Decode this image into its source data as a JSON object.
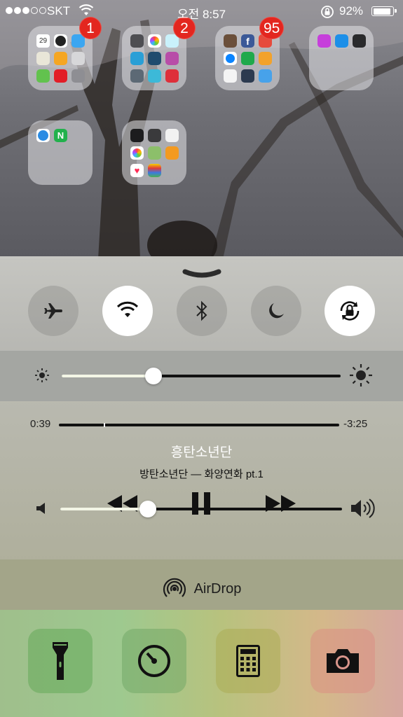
{
  "status_bar": {
    "carrier": "SKT",
    "time": "오전 8:57",
    "battery": "92%"
  },
  "folders": [
    {
      "badge": "1"
    },
    {
      "badge": "2"
    },
    {
      "badge": "95"
    },
    {
      "badge": ""
    },
    {
      "badge": ""
    },
    {
      "badge": ""
    }
  ],
  "calendar_day": "29",
  "control_center": {
    "toggles": [
      {
        "name": "airplane-mode",
        "on": false
      },
      {
        "name": "wifi",
        "on": true
      },
      {
        "name": "bluetooth",
        "on": false
      },
      {
        "name": "do-not-disturb",
        "on": false
      },
      {
        "name": "rotation-lock",
        "on": true
      }
    ],
    "brightness": 0.33,
    "music": {
      "elapsed": "0:39",
      "remaining": "-3:25",
      "title": "흥탄소년단",
      "subtitle": "방탄소년단 — 화양연화 pt.1",
      "progress": 0.16
    },
    "volume": 0.31,
    "airdrop_label": "AirDrop",
    "tools": [
      "flashlight",
      "timer",
      "calculator",
      "camera"
    ]
  }
}
